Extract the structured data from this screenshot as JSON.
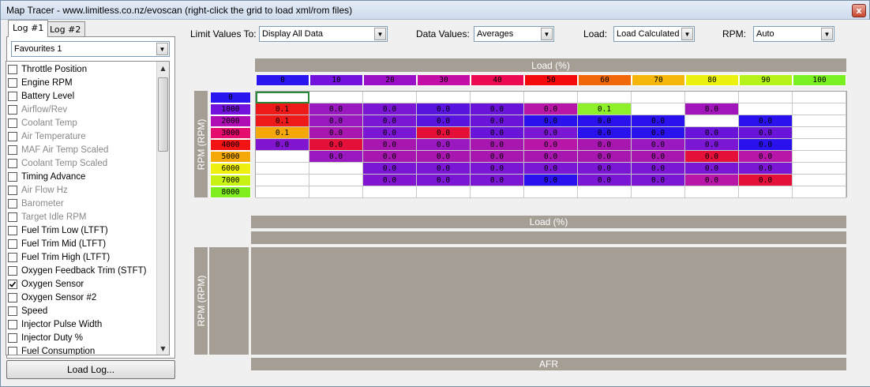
{
  "window": {
    "title": "Map Tracer - www.limitless.co.nz/evoscan (right-click the grid to load xml/rom files)",
    "close_glyph": "x"
  },
  "tabs": [
    {
      "label": "Log #1",
      "active": true
    },
    {
      "label": "Log #2",
      "active": false
    }
  ],
  "favourites": {
    "selected": "Favourites 1"
  },
  "params": [
    {
      "label": "Throttle Position",
      "checked": false,
      "grey": false
    },
    {
      "label": "Engine RPM",
      "checked": false,
      "grey": false
    },
    {
      "label": "Battery Level",
      "checked": false,
      "grey": false
    },
    {
      "label": "Airflow/Rev",
      "checked": false,
      "grey": true
    },
    {
      "label": "Coolant Temp",
      "checked": false,
      "grey": true
    },
    {
      "label": "Air Temperature",
      "checked": false,
      "grey": true
    },
    {
      "label": "MAF Air Temp Scaled",
      "checked": false,
      "grey": true
    },
    {
      "label": "Coolant Temp Scaled",
      "checked": false,
      "grey": true
    },
    {
      "label": "Timing Advance",
      "checked": false,
      "grey": false
    },
    {
      "label": "Air Flow Hz",
      "checked": false,
      "grey": true
    },
    {
      "label": "Barometer",
      "checked": false,
      "grey": true
    },
    {
      "label": "Target Idle RPM",
      "checked": false,
      "grey": true
    },
    {
      "label": "Fuel Trim Low (LTFT)",
      "checked": false,
      "grey": false
    },
    {
      "label": "Fuel Trim Mid (LTFT)",
      "checked": false,
      "grey": false
    },
    {
      "label": "Fuel Trim High (LTFT)",
      "checked": false,
      "grey": false
    },
    {
      "label": "Oxygen Feedback Trim (STFT)",
      "checked": false,
      "grey": false
    },
    {
      "label": "Oxygen Sensor",
      "checked": true,
      "grey": false
    },
    {
      "label": "Oxygen Sensor #2",
      "checked": false,
      "grey": false
    },
    {
      "label": "Speed",
      "checked": false,
      "grey": false
    },
    {
      "label": "Injector Pulse Width",
      "checked": false,
      "grey": false
    },
    {
      "label": "Injector Duty %",
      "checked": false,
      "grey": false
    },
    {
      "label": "Fuel Consumption",
      "checked": false,
      "grey": false
    }
  ],
  "load_log_label": "Load Log...",
  "toolbar": {
    "limit_label": "Limit Values To:",
    "limit_value": "Display All Data",
    "data_label": "Data Values:",
    "data_value": "Averages",
    "load_label": "Load:",
    "load_value": "Load Calculated",
    "rpm_label": "RPM:",
    "rpm_value": "Auto"
  },
  "grid": {
    "x_axis_label": "Load (%)",
    "y_axis_label": "RPM (RPM)",
    "columns": [
      {
        "label": "0",
        "color": "#2a16ee"
      },
      {
        "label": "10",
        "color": "#7212dc"
      },
      {
        "label": "20",
        "color": "#9a10c6"
      },
      {
        "label": "30",
        "color": "#c40ea8"
      },
      {
        "label": "40",
        "color": "#ec0a52"
      },
      {
        "label": "50",
        "color": "#f40a0a"
      },
      {
        "label": "60",
        "color": "#f0680a"
      },
      {
        "label": "70",
        "color": "#f4b60a"
      },
      {
        "label": "80",
        "color": "#ecf210"
      },
      {
        "label": "90",
        "color": "#b4f21a"
      },
      {
        "label": "100",
        "color": "#7af022"
      }
    ],
    "rows": [
      {
        "label": "0",
        "color": "#2a16ee"
      },
      {
        "label": "1000",
        "color": "#7212dc"
      },
      {
        "label": "2000",
        "color": "#b00eb4"
      },
      {
        "label": "3000",
        "color": "#e40c6c"
      },
      {
        "label": "4000",
        "color": "#f21414"
      },
      {
        "label": "5000",
        "color": "#f4a80a"
      },
      {
        "label": "6000",
        "color": "#f0f010"
      },
      {
        "label": "7000",
        "color": "#c8f214"
      },
      {
        "label": "8000",
        "color": "#80ee1e"
      }
    ],
    "cells": [
      [
        {
          "v": "",
          "c": "#ffffff",
          "sel": true
        },
        {
          "v": "",
          "c": "#ffffff"
        },
        {
          "v": "",
          "c": "#ffffff"
        },
        {
          "v": "",
          "c": "#ffffff"
        },
        {
          "v": "",
          "c": "#ffffff"
        },
        {
          "v": "",
          "c": "#ffffff"
        },
        {
          "v": "",
          "c": "#ffffff"
        },
        {
          "v": "",
          "c": "#ffffff"
        },
        {
          "v": "",
          "c": "#ffffff"
        },
        {
          "v": "",
          "c": "#ffffff"
        },
        {
          "v": "",
          "c": "#ffffff"
        }
      ],
      [
        {
          "v": "0.1",
          "c": "#ee1a1a"
        },
        {
          "v": "0.0",
          "c": "#9a18c0"
        },
        {
          "v": "0.0",
          "c": "#7a16d4"
        },
        {
          "v": "0.0",
          "c": "#5a14e0"
        },
        {
          "v": "0.0",
          "c": "#6a14da"
        },
        {
          "v": "0.0",
          "c": "#b816a8"
        },
        {
          "v": "0.1",
          "c": "#8ef028"
        },
        {
          "v": "",
          "c": "#ffffff"
        },
        {
          "v": "0.0",
          "c": "#a016ba"
        },
        {
          "v": "",
          "c": "#ffffff"
        },
        {
          "v": "",
          "c": "#ffffff"
        }
      ],
      [
        {
          "v": "0.1",
          "c": "#ee1a1a"
        },
        {
          "v": "0.0",
          "c": "#9a18c0"
        },
        {
          "v": "0.0",
          "c": "#7a16d4"
        },
        {
          "v": "0.0",
          "c": "#5a14e0"
        },
        {
          "v": "0.0",
          "c": "#6a14da"
        },
        {
          "v": "0.0",
          "c": "#2a12ee"
        },
        {
          "v": "0.0",
          "c": "#2a12ee"
        },
        {
          "v": "0.0",
          "c": "#2a12ee"
        },
        {
          "v": "",
          "c": "#ffffff"
        },
        {
          "v": "0.0",
          "c": "#2a12ee"
        },
        {
          "v": "",
          "c": "#ffffff"
        }
      ],
      [
        {
          "v": "0.1",
          "c": "#f4a80a"
        },
        {
          "v": "0.0",
          "c": "#a816b0"
        },
        {
          "v": "0.0",
          "c": "#7a16d4"
        },
        {
          "v": "0.0",
          "c": "#e4103a"
        },
        {
          "v": "0.0",
          "c": "#6a14da"
        },
        {
          "v": "0.0",
          "c": "#7a16d4"
        },
        {
          "v": "0.0",
          "c": "#2a12ee"
        },
        {
          "v": "0.0",
          "c": "#2a12ee"
        },
        {
          "v": "0.0",
          "c": "#6a14da"
        },
        {
          "v": "0.0",
          "c": "#6a14da"
        },
        {
          "v": "",
          "c": "#ffffff"
        }
      ],
      [
        {
          "v": "0.0",
          "c": "#8216d0"
        },
        {
          "v": "0.0",
          "c": "#e4103a"
        },
        {
          "v": "0.0",
          "c": "#a816b0"
        },
        {
          "v": "0.0",
          "c": "#9a18c0"
        },
        {
          "v": "0.0",
          "c": "#a816b0"
        },
        {
          "v": "0.0",
          "c": "#b816a8"
        },
        {
          "v": "0.0",
          "c": "#a816b0"
        },
        {
          "v": "0.0",
          "c": "#9a18c0"
        },
        {
          "v": "0.0",
          "c": "#7a16d4"
        },
        {
          "v": "0.0",
          "c": "#2a12ee"
        },
        {
          "v": "",
          "c": "#ffffff"
        }
      ],
      [
        {
          "v": "",
          "c": "#ffffff"
        },
        {
          "v": "0.0",
          "c": "#9a18c0"
        },
        {
          "v": "0.0",
          "c": "#a816b0"
        },
        {
          "v": "0.0",
          "c": "#a816b0"
        },
        {
          "v": "0.0",
          "c": "#a816b0"
        },
        {
          "v": "0.0",
          "c": "#a816b0"
        },
        {
          "v": "0.0",
          "c": "#a816b0"
        },
        {
          "v": "0.0",
          "c": "#a816b0"
        },
        {
          "v": "0.0",
          "c": "#e4103a"
        },
        {
          "v": "0.0",
          "c": "#b816a8"
        },
        {
          "v": "",
          "c": "#ffffff"
        }
      ],
      [
        {
          "v": "",
          "c": "#ffffff"
        },
        {
          "v": "",
          "c": "#ffffff"
        },
        {
          "v": "0.0",
          "c": "#7a16d4"
        },
        {
          "v": "0.0",
          "c": "#7a16d4"
        },
        {
          "v": "0.0",
          "c": "#7a16d4"
        },
        {
          "v": "0.0",
          "c": "#7a16d4"
        },
        {
          "v": "0.0",
          "c": "#7a16d4"
        },
        {
          "v": "0.0",
          "c": "#7a16d4"
        },
        {
          "v": "0.0",
          "c": "#7a16d4"
        },
        {
          "v": "0.0",
          "c": "#7a16d4"
        },
        {
          "v": "",
          "c": "#ffffff"
        }
      ],
      [
        {
          "v": "",
          "c": "#ffffff"
        },
        {
          "v": "",
          "c": "#ffffff"
        },
        {
          "v": "0.0",
          "c": "#8216d0"
        },
        {
          "v": "0.0",
          "c": "#7a16d4"
        },
        {
          "v": "0.0",
          "c": "#7a16d4"
        },
        {
          "v": "0.0",
          "c": "#2a12ee"
        },
        {
          "v": "0.0",
          "c": "#7a16d4"
        },
        {
          "v": "0.0",
          "c": "#7a16d4"
        },
        {
          "v": "0.0",
          "c": "#b816a8"
        },
        {
          "v": "0.0",
          "c": "#e4103a"
        },
        {
          "v": "",
          "c": "#ffffff"
        }
      ],
      [
        {
          "v": "",
          "c": "#ffffff"
        },
        {
          "v": "",
          "c": "#ffffff"
        },
        {
          "v": "",
          "c": "#ffffff"
        },
        {
          "v": "",
          "c": "#ffffff"
        },
        {
          "v": "",
          "c": "#ffffff"
        },
        {
          "v": "",
          "c": "#ffffff"
        },
        {
          "v": "",
          "c": "#ffffff"
        },
        {
          "v": "",
          "c": "#ffffff"
        },
        {
          "v": "",
          "c": "#ffffff"
        },
        {
          "v": "",
          "c": "#ffffff"
        },
        {
          "v": "",
          "c": "#ffffff"
        }
      ]
    ]
  },
  "afr_panel": {
    "x_axis_label": "Load (%)",
    "y_axis_label": "RPM (RPM)",
    "bottom_label": "AFR"
  }
}
